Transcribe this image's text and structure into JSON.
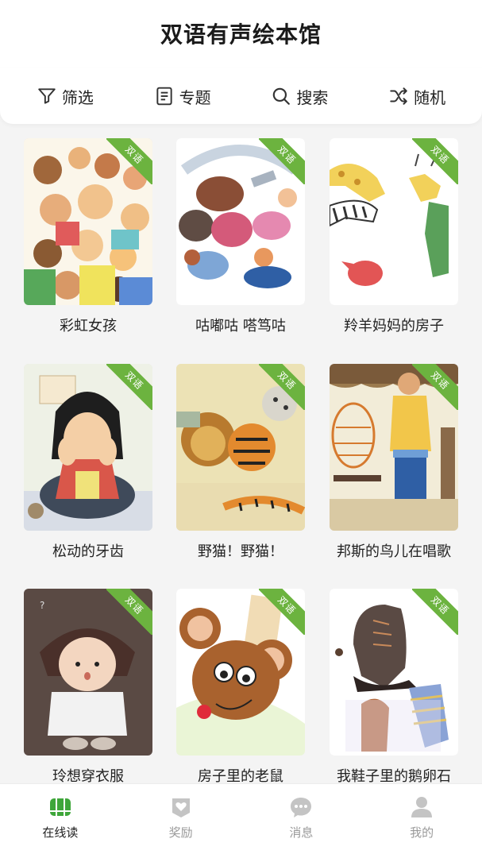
{
  "app": {
    "title": "双语有声绘本馆"
  },
  "toolbar": {
    "filter_label": "筛选",
    "topic_label": "专题",
    "search_label": "搜索",
    "random_label": "随机"
  },
  "badge_text": "双语",
  "books": [
    {
      "title": "彩虹女孩"
    },
    {
      "title": "咕嘟咕 嗒笃咕"
    },
    {
      "title": "羚羊妈妈的房子"
    },
    {
      "title": "松动的牙齿"
    },
    {
      "title": "野猫！野猫！"
    },
    {
      "title": "邦斯的鸟儿在唱歌"
    },
    {
      "title": "玲想穿衣服"
    },
    {
      "title": "房子里的老鼠"
    },
    {
      "title": "我鞋子里的鹅卵石"
    }
  ],
  "tabbar": {
    "items": [
      {
        "label": "在线读",
        "icon": "books-icon",
        "active": true
      },
      {
        "label": "奖励",
        "icon": "reward-heart-icon",
        "active": false
      },
      {
        "label": "消息",
        "icon": "message-bubble-icon",
        "active": false
      },
      {
        "label": "我的",
        "icon": "user-icon",
        "active": false
      }
    ]
  },
  "colors": {
    "accent": "#6cb33f",
    "background": "#f4f4f4",
    "inactive_text": "#9a9a9a"
  }
}
